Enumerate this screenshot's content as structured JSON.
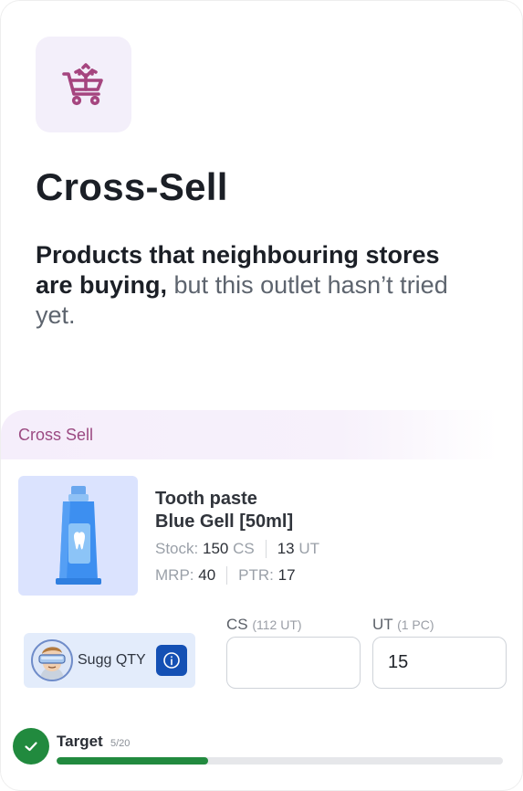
{
  "hero": {
    "icon": "cart-cross-sell-icon",
    "title": "Cross-Sell",
    "subtitle_strong": "Products that neighbouring stores are buying,",
    "subtitle_rest": " but this outlet hasn’t tried yet."
  },
  "section": {
    "label": "Cross Sell"
  },
  "product": {
    "image_icon": "toothpaste-tube-icon",
    "name_line1": "Tooth paste",
    "name_line2": "Blue Gell [50ml]",
    "stock_label": "Stock:",
    "stock_cs_value": "150",
    "stock_cs_unit": "CS",
    "stock_ut_value": "13",
    "stock_ut_unit": "UT",
    "mrp_label": "MRP:",
    "mrp_value": "40",
    "ptr_label": "PTR:",
    "ptr_value": "17"
  },
  "suggestion": {
    "label": "Sugg QTY",
    "info_icon": "info-icon",
    "avatar_icon": "vr-avatar-icon"
  },
  "quantity": {
    "cs_label": "CS",
    "cs_hint": "(112 UT)",
    "cs_value": "",
    "ut_label": "UT",
    "ut_hint": "(1 PC)",
    "ut_value": "15"
  },
  "target": {
    "label": "Target",
    "count": "5/20",
    "progress_fraction": 0.34,
    "done_icon": "check-icon"
  },
  "colors": {
    "accent_purple": "#9b4a82",
    "info_blue": "#1450b4",
    "success_green": "#218a3e"
  }
}
